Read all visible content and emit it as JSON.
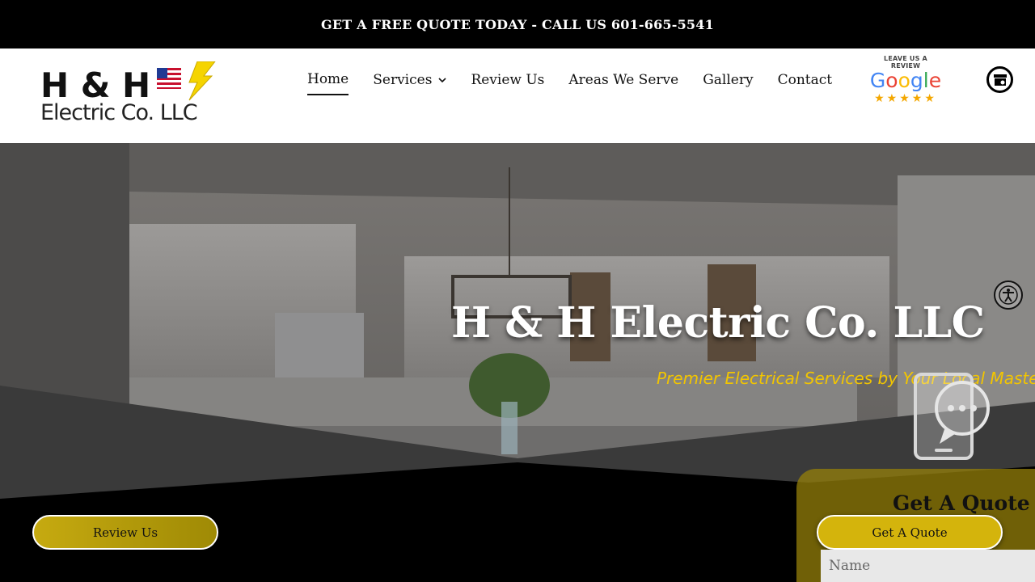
{
  "topbar": {
    "text": "GET A FREE QUOTE TODAY - CALL US 601-665-5541"
  },
  "logo": {
    "line1": "H & H",
    "line2": "Electric Co. LLC"
  },
  "nav": {
    "items": [
      {
        "label": "Home"
      },
      {
        "label": "Services"
      },
      {
        "label": "Review Us"
      },
      {
        "label": "Areas We Serve"
      },
      {
        "label": "Gallery"
      },
      {
        "label": "Contact"
      }
    ]
  },
  "review_badge": {
    "caption": "LEAVE US A REVIEW",
    "brand": "Google",
    "stars": "★★★★★"
  },
  "hero": {
    "title": "H & H Electric Co. LLC",
    "subtitle": "Premier Electrical Services by Your Local Master"
  },
  "buttons": {
    "review": "Review Us",
    "quote": "Get A Quote"
  },
  "quote_form": {
    "heading": "Get A Quote",
    "name_placeholder": "Name"
  },
  "colors": {
    "accent_yellow": "#d4b40c",
    "subtitle_yellow": "#f2c500",
    "topbar_bg": "#000000"
  },
  "icons": [
    "chevron-down-icon",
    "google-business-icon",
    "accessibility-icon",
    "chat-phone-icon"
  ]
}
